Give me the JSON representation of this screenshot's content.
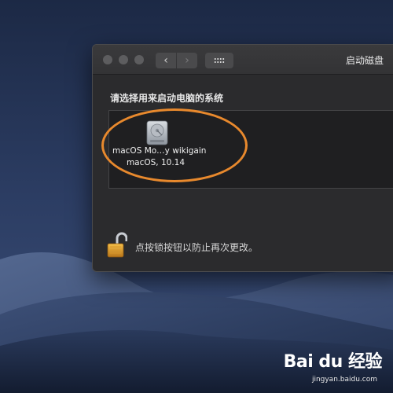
{
  "window": {
    "title": "启动磁盘",
    "back_symbol": "‹",
    "forward_symbol": "›"
  },
  "section": {
    "label": "请选择用来启动电脑的系统"
  },
  "disk": {
    "name": "macOS Mo…y wikigain",
    "version": "macOS, 10.14",
    "icon": "hard-drive-icon"
  },
  "lock": {
    "text": "点按锁按钮以防止再次更改。",
    "icon": "unlocked-padlock-icon"
  },
  "watermark": {
    "logo": "Bai du 经验",
    "url": "jingyan.baidu.com"
  },
  "colors": {
    "highlight_ring": "#e8892d",
    "window_bg": "#2b2b2d"
  }
}
